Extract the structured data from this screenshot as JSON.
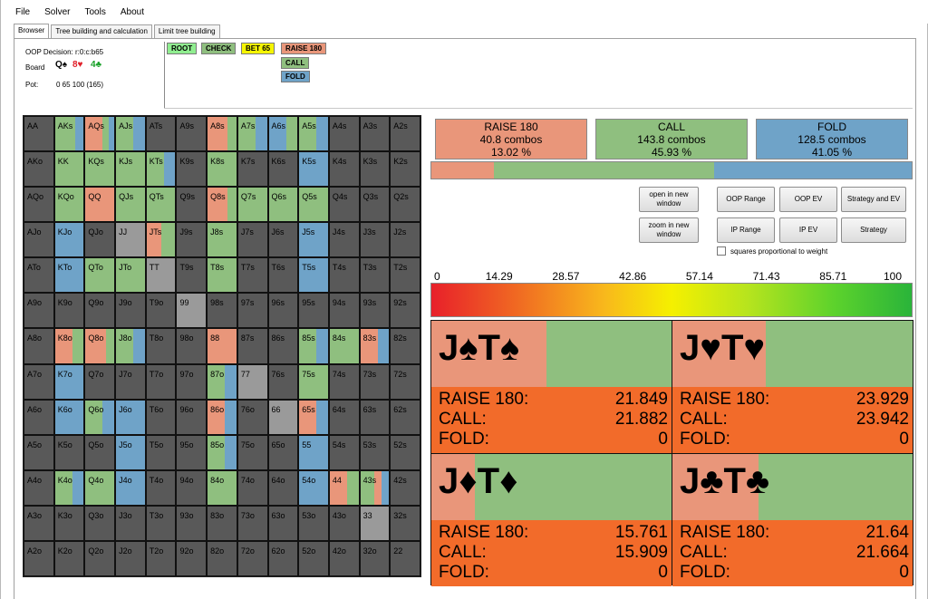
{
  "menu": [
    "File",
    "Solver",
    "Tools",
    "About"
  ],
  "tabs": [
    {
      "label": "Browser",
      "active": true
    },
    {
      "label": "Tree building and calculation",
      "active": false
    },
    {
      "label": "Limit tree building",
      "active": false
    }
  ],
  "info": {
    "decision": "OOP Decision: r:0:c:b65",
    "board_label": "Board",
    "board_cards": [
      {
        "text": "Q♠",
        "color": "#000000"
      },
      {
        "text": "8♥",
        "color": "#e0202a"
      },
      {
        "text": "4♣",
        "color": "#18a028"
      }
    ],
    "pot_label": "Pot:",
    "pot_value": "0 65 100 (165)"
  },
  "tree": [
    {
      "label": "ROOT",
      "color": "#90ee90"
    },
    {
      "label": "CHECK",
      "color": "#8fbf7f"
    },
    {
      "label": "BET 65",
      "color": "#f5f500"
    },
    {
      "label": "RAISE 180",
      "color": "#e9967a"
    },
    {
      "label": "CALL",
      "color": "#8fbf7f"
    },
    {
      "label": "FOLD",
      "color": "#6fa3c8"
    }
  ],
  "colors": {
    "raise": "#e9967a",
    "call": "#8fbf7f",
    "fold": "#6fa3c8",
    "empty": "#595959",
    "gray": "#9a9a9a"
  },
  "grid": [
    [
      "AA",
      "AKs",
      "AQs",
      "AJs",
      "ATs",
      "A9s",
      "A8s",
      "A7s",
      "A6s",
      "A5s",
      "A4s",
      "A3s",
      "A2s"
    ],
    [
      "AKo",
      "KK",
      "KQs",
      "KJs",
      "KTs",
      "K9s",
      "K8s",
      "K7s",
      "K6s",
      "K5s",
      "K4s",
      "K3s",
      "K2s"
    ],
    [
      "AQo",
      "KQo",
      "QQ",
      "QJs",
      "QTs",
      "Q9s",
      "Q8s",
      "Q7s",
      "Q6s",
      "Q5s",
      "Q4s",
      "Q3s",
      "Q2s"
    ],
    [
      "AJo",
      "KJo",
      "QJo",
      "JJ",
      "JTs",
      "J9s",
      "J8s",
      "J7s",
      "J6s",
      "J5s",
      "J4s",
      "J3s",
      "J2s"
    ],
    [
      "ATo",
      "KTo",
      "QTo",
      "JTo",
      "TT",
      "T9s",
      "T8s",
      "T7s",
      "T6s",
      "T5s",
      "T4s",
      "T3s",
      "T2s"
    ],
    [
      "A9o",
      "K9o",
      "Q9o",
      "J9o",
      "T9o",
      "99",
      "98s",
      "97s",
      "96s",
      "95s",
      "94s",
      "93s",
      "92s"
    ],
    [
      "A8o",
      "K8o",
      "Q8o",
      "J8o",
      "T8o",
      "98o",
      "88",
      "87s",
      "86s",
      "85s",
      "84s",
      "83s",
      "82s"
    ],
    [
      "A7o",
      "K7o",
      "Q7o",
      "J7o",
      "T7o",
      "97o",
      "87o",
      "77",
      "76s",
      "75s",
      "74s",
      "73s",
      "72s"
    ],
    [
      "A6o",
      "K6o",
      "Q6o",
      "J6o",
      "T6o",
      "96o",
      "86o",
      "76o",
      "66",
      "65s",
      "64s",
      "63s",
      "62s"
    ],
    [
      "A5o",
      "K5o",
      "Q5o",
      "J5o",
      "T5o",
      "95o",
      "85o",
      "75o",
      "65o",
      "55",
      "54s",
      "53s",
      "52s"
    ],
    [
      "A4o",
      "K4o",
      "Q4o",
      "J4o",
      "T4o",
      "94o",
      "84o",
      "74o",
      "64o",
      "54o",
      "44",
      "43s",
      "42s"
    ],
    [
      "A3o",
      "K3o",
      "Q3o",
      "J3o",
      "T3o",
      "93o",
      "83o",
      "73o",
      "63o",
      "53o",
      "43o",
      "33",
      "32s"
    ],
    [
      "A2o",
      "K2o",
      "Q2o",
      "J2o",
      "T2o",
      "92o",
      "82o",
      "72o",
      "62o",
      "52o",
      "42o",
      "32o",
      "22"
    ]
  ],
  "strategy": {
    "AKs": [
      [
        0.7,
        "call"
      ],
      [
        0.3,
        "fold"
      ]
    ],
    "AQs": [
      [
        0.6,
        "raise"
      ],
      [
        0.2,
        "call"
      ],
      [
        0.2,
        "fold"
      ]
    ],
    "AJs": [
      [
        0.6,
        "call"
      ],
      [
        0.4,
        "fold"
      ]
    ],
    "A8s": [
      [
        0.7,
        "raise"
      ],
      [
        0.3,
        "call"
      ]
    ],
    "A7s": [
      [
        0.6,
        "call"
      ],
      [
        0.4,
        "fold"
      ]
    ],
    "A6s": [
      [
        0.6,
        "fold"
      ],
      [
        0.4,
        "call"
      ]
    ],
    "A5s": [
      [
        0.6,
        "call"
      ],
      [
        0.4,
        "fold"
      ]
    ],
    "KK": [
      [
        1.0,
        "call"
      ]
    ],
    "KQs": [
      [
        1.0,
        "call"
      ]
    ],
    "KJs": [
      [
        1.0,
        "call"
      ]
    ],
    "KTs": [
      [
        0.6,
        "call"
      ],
      [
        0.4,
        "fold"
      ]
    ],
    "K8s": [
      [
        1.0,
        "call"
      ]
    ],
    "K5s": [
      [
        1.0,
        "fold"
      ]
    ],
    "KQo": [
      [
        1.0,
        "call"
      ]
    ],
    "QQ": [
      [
        1.0,
        "raise"
      ]
    ],
    "QJs": [
      [
        1.0,
        "call"
      ]
    ],
    "QTs": [
      [
        1.0,
        "call"
      ]
    ],
    "Q8s": [
      [
        0.7,
        "raise"
      ],
      [
        0.3,
        "call"
      ]
    ],
    "Q7s": [
      [
        1.0,
        "call"
      ]
    ],
    "Q6s": [
      [
        1.0,
        "call"
      ]
    ],
    "Q5s": [
      [
        1.0,
        "call"
      ]
    ],
    "KJo": [
      [
        1.0,
        "fold"
      ]
    ],
    "JJ": [
      [
        1.0,
        "gray"
      ]
    ],
    "JTs": [
      [
        0.5,
        "raise"
      ],
      [
        0.5,
        "call"
      ]
    ],
    "J8s": [
      [
        1.0,
        "call"
      ]
    ],
    "J5s": [
      [
        1.0,
        "fold"
      ]
    ],
    "KTo": [
      [
        1.0,
        "fold"
      ]
    ],
    "QTo": [
      [
        1.0,
        "call"
      ]
    ],
    "JTo": [
      [
        1.0,
        "call"
      ]
    ],
    "TT": [
      [
        1.0,
        "gray"
      ]
    ],
    "T8s": [
      [
        1.0,
        "call"
      ]
    ],
    "T5s": [
      [
        1.0,
        "fold"
      ]
    ],
    "99": [
      [
        1.0,
        "gray"
      ]
    ],
    "K8o": [
      [
        0.6,
        "raise"
      ],
      [
        0.4,
        "call"
      ]
    ],
    "Q8o": [
      [
        0.7,
        "raise"
      ],
      [
        0.3,
        "call"
      ]
    ],
    "J8o": [
      [
        0.6,
        "call"
      ],
      [
        0.4,
        "fold"
      ]
    ],
    "88": [
      [
        1.0,
        "raise"
      ]
    ],
    "85s": [
      [
        0.6,
        "call"
      ],
      [
        0.4,
        "fold"
      ]
    ],
    "84s": [
      [
        1.0,
        "call"
      ]
    ],
    "83s": [
      [
        0.6,
        "raise"
      ],
      [
        0.4,
        "fold"
      ]
    ],
    "K7o": [
      [
        1.0,
        "fold"
      ]
    ],
    "87o": [
      [
        0.6,
        "call"
      ],
      [
        0.4,
        "fold"
      ]
    ],
    "77": [
      [
        1.0,
        "gray"
      ]
    ],
    "75s": [
      [
        1.0,
        "call"
      ]
    ],
    "K6o": [
      [
        1.0,
        "fold"
      ]
    ],
    "Q6o": [
      [
        0.6,
        "call"
      ],
      [
        0.4,
        "fold"
      ]
    ],
    "J6o": [
      [
        1.0,
        "fold"
      ]
    ],
    "86o": [
      [
        0.6,
        "raise"
      ],
      [
        0.4,
        "fold"
      ]
    ],
    "66": [
      [
        1.0,
        "gray"
      ]
    ],
    "65s": [
      [
        0.6,
        "raise"
      ],
      [
        0.4,
        "fold"
      ]
    ],
    "J5o": [
      [
        1.0,
        "fold"
      ]
    ],
    "85o": [
      [
        0.6,
        "call"
      ],
      [
        0.4,
        "fold"
      ]
    ],
    "55": [
      [
        1.0,
        "fold"
      ]
    ],
    "K4o": [
      [
        0.6,
        "call"
      ],
      [
        0.4,
        "fold"
      ]
    ],
    "Q4o": [
      [
        1.0,
        "call"
      ]
    ],
    "J4o": [
      [
        1.0,
        "fold"
      ]
    ],
    "84o": [
      [
        1.0,
        "call"
      ]
    ],
    "54o": [
      [
        1.0,
        "fold"
      ]
    ],
    "44": [
      [
        0.6,
        "raise"
      ],
      [
        0.4,
        "call"
      ]
    ],
    "43s": [
      [
        0.5,
        "call"
      ],
      [
        0.25,
        "raise"
      ],
      [
        0.25,
        "fold"
      ]
    ],
    "33": [
      [
        1.0,
        "gray"
      ]
    ]
  },
  "summary": [
    {
      "action": "RAISE 180",
      "combos": "40.8 combos",
      "pct": "13.02 %",
      "color": "#e9967a",
      "freq": 13.02
    },
    {
      "action": "CALL",
      "combos": "143.8 combos",
      "pct": "45.93 %",
      "color": "#8fbf7f",
      "freq": 45.93
    },
    {
      "action": "FOLD",
      "combos": "128.5 combos",
      "pct": "41.05 %",
      "color": "#6fa3c8",
      "freq": 41.05
    }
  ],
  "buttons": {
    "open_new": "open in new window",
    "zoom_new": "zoom in new window",
    "oop_range": "OOP Range",
    "oop_ev": "OOP EV",
    "strategy_ev": "Strategy and EV",
    "ip_range": "IP Range",
    "ip_ev": "IP  EV",
    "strategy": "Strategy"
  },
  "checkbox_label": "squares proportional to weight",
  "scale": [
    "0",
    "14.29",
    "28.57",
    "42.86",
    "57.14",
    "71.43",
    "85.71",
    "100"
  ],
  "combos": [
    {
      "cards": "J♠T♠",
      "raise_freq": 0.48,
      "raise": "21.849",
      "call": "21.882",
      "fold": "0"
    },
    {
      "cards": "J♥T♥",
      "raise_freq": 0.39,
      "raise": "23.929",
      "call": "23.942",
      "fold": "0"
    },
    {
      "cards": "J♦T♦",
      "raise_freq": 0.18,
      "raise": "15.761",
      "call": "15.909",
      "fold": "0"
    },
    {
      "cards": "J♣T♣",
      "raise_freq": 0.36,
      "raise": "21.64",
      "call": "21.664",
      "fold": "0"
    }
  ],
  "combo_labels": {
    "raise": "RAISE 180:",
    "call": "CALL:",
    "fold": "FOLD:"
  }
}
